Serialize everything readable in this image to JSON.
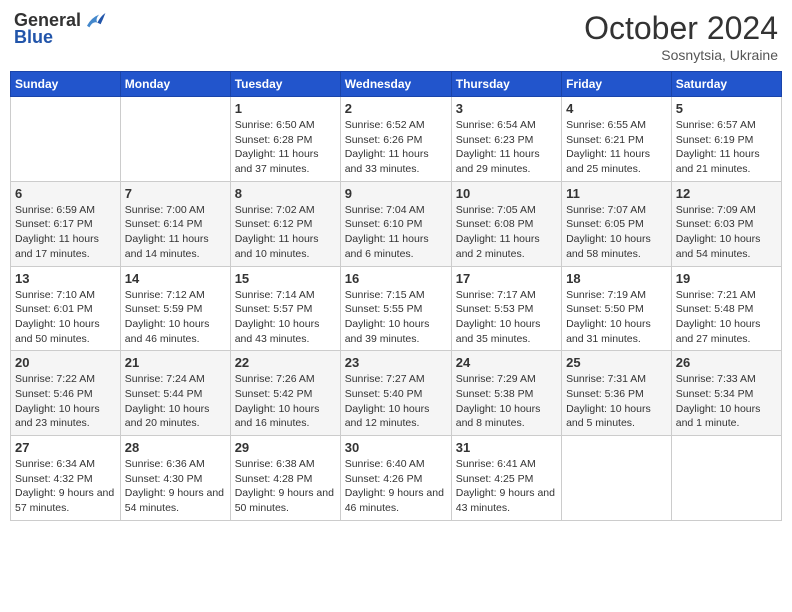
{
  "header": {
    "logo": {
      "text1": "General",
      "text2": "Blue"
    },
    "title": "October 2024",
    "subtitle": "Sosnytsia, Ukraine"
  },
  "days_of_week": [
    "Sunday",
    "Monday",
    "Tuesday",
    "Wednesday",
    "Thursday",
    "Friday",
    "Saturday"
  ],
  "weeks": [
    [
      {
        "day": "",
        "info": ""
      },
      {
        "day": "",
        "info": ""
      },
      {
        "day": "1",
        "info": "Sunrise: 6:50 AM\nSunset: 6:28 PM\nDaylight: 11 hours and 37 minutes."
      },
      {
        "day": "2",
        "info": "Sunrise: 6:52 AM\nSunset: 6:26 PM\nDaylight: 11 hours and 33 minutes."
      },
      {
        "day": "3",
        "info": "Sunrise: 6:54 AM\nSunset: 6:23 PM\nDaylight: 11 hours and 29 minutes."
      },
      {
        "day": "4",
        "info": "Sunrise: 6:55 AM\nSunset: 6:21 PM\nDaylight: 11 hours and 25 minutes."
      },
      {
        "day": "5",
        "info": "Sunrise: 6:57 AM\nSunset: 6:19 PM\nDaylight: 11 hours and 21 minutes."
      }
    ],
    [
      {
        "day": "6",
        "info": "Sunrise: 6:59 AM\nSunset: 6:17 PM\nDaylight: 11 hours and 17 minutes."
      },
      {
        "day": "7",
        "info": "Sunrise: 7:00 AM\nSunset: 6:14 PM\nDaylight: 11 hours and 14 minutes."
      },
      {
        "day": "8",
        "info": "Sunrise: 7:02 AM\nSunset: 6:12 PM\nDaylight: 11 hours and 10 minutes."
      },
      {
        "day": "9",
        "info": "Sunrise: 7:04 AM\nSunset: 6:10 PM\nDaylight: 11 hours and 6 minutes."
      },
      {
        "day": "10",
        "info": "Sunrise: 7:05 AM\nSunset: 6:08 PM\nDaylight: 11 hours and 2 minutes."
      },
      {
        "day": "11",
        "info": "Sunrise: 7:07 AM\nSunset: 6:05 PM\nDaylight: 10 hours and 58 minutes."
      },
      {
        "day": "12",
        "info": "Sunrise: 7:09 AM\nSunset: 6:03 PM\nDaylight: 10 hours and 54 minutes."
      }
    ],
    [
      {
        "day": "13",
        "info": "Sunrise: 7:10 AM\nSunset: 6:01 PM\nDaylight: 10 hours and 50 minutes."
      },
      {
        "day": "14",
        "info": "Sunrise: 7:12 AM\nSunset: 5:59 PM\nDaylight: 10 hours and 46 minutes."
      },
      {
        "day": "15",
        "info": "Sunrise: 7:14 AM\nSunset: 5:57 PM\nDaylight: 10 hours and 43 minutes."
      },
      {
        "day": "16",
        "info": "Sunrise: 7:15 AM\nSunset: 5:55 PM\nDaylight: 10 hours and 39 minutes."
      },
      {
        "day": "17",
        "info": "Sunrise: 7:17 AM\nSunset: 5:53 PM\nDaylight: 10 hours and 35 minutes."
      },
      {
        "day": "18",
        "info": "Sunrise: 7:19 AM\nSunset: 5:50 PM\nDaylight: 10 hours and 31 minutes."
      },
      {
        "day": "19",
        "info": "Sunrise: 7:21 AM\nSunset: 5:48 PM\nDaylight: 10 hours and 27 minutes."
      }
    ],
    [
      {
        "day": "20",
        "info": "Sunrise: 7:22 AM\nSunset: 5:46 PM\nDaylight: 10 hours and 23 minutes."
      },
      {
        "day": "21",
        "info": "Sunrise: 7:24 AM\nSunset: 5:44 PM\nDaylight: 10 hours and 20 minutes."
      },
      {
        "day": "22",
        "info": "Sunrise: 7:26 AM\nSunset: 5:42 PM\nDaylight: 10 hours and 16 minutes."
      },
      {
        "day": "23",
        "info": "Sunrise: 7:27 AM\nSunset: 5:40 PM\nDaylight: 10 hours and 12 minutes."
      },
      {
        "day": "24",
        "info": "Sunrise: 7:29 AM\nSunset: 5:38 PM\nDaylight: 10 hours and 8 minutes."
      },
      {
        "day": "25",
        "info": "Sunrise: 7:31 AM\nSunset: 5:36 PM\nDaylight: 10 hours and 5 minutes."
      },
      {
        "day": "26",
        "info": "Sunrise: 7:33 AM\nSunset: 5:34 PM\nDaylight: 10 hours and 1 minute."
      }
    ],
    [
      {
        "day": "27",
        "info": "Sunrise: 6:34 AM\nSunset: 4:32 PM\nDaylight: 9 hours and 57 minutes."
      },
      {
        "day": "28",
        "info": "Sunrise: 6:36 AM\nSunset: 4:30 PM\nDaylight: 9 hours and 54 minutes."
      },
      {
        "day": "29",
        "info": "Sunrise: 6:38 AM\nSunset: 4:28 PM\nDaylight: 9 hours and 50 minutes."
      },
      {
        "day": "30",
        "info": "Sunrise: 6:40 AM\nSunset: 4:26 PM\nDaylight: 9 hours and 46 minutes."
      },
      {
        "day": "31",
        "info": "Sunrise: 6:41 AM\nSunset: 4:25 PM\nDaylight: 9 hours and 43 minutes."
      },
      {
        "day": "",
        "info": ""
      },
      {
        "day": "",
        "info": ""
      }
    ]
  ]
}
